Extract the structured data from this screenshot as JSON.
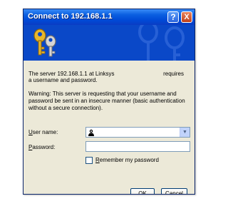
{
  "window": {
    "title": "Connect to 192.168.1.1",
    "help_label": "?",
    "close_label": "X"
  },
  "message": {
    "line1": "The server 192.168.1.1 at Linksys",
    "requires": "requires",
    "line2": "a username and password.",
    "warning": "Warning: This server is requesting that your username and password be sent in an insecure manner (basic authentication without a secure connection)."
  },
  "form": {
    "user_label_u": "U",
    "user_label_rest": "ser name:",
    "user_value": "",
    "password_label_u": "P",
    "password_label_rest": "assword:",
    "password_value": "",
    "remember_u": "R",
    "remember_rest": "emember my password",
    "remember_checked": false
  },
  "buttons": {
    "ok": "OK",
    "cancel": "Cancel"
  },
  "colors": {
    "titlebar": "#0a5fe0",
    "dialog_bg": "#ece9d8",
    "field_border": "#7f9db9"
  },
  "icons": {
    "banner": "keys-icon",
    "user_field": "user-icon",
    "dropdown": "chevron-down-icon"
  }
}
